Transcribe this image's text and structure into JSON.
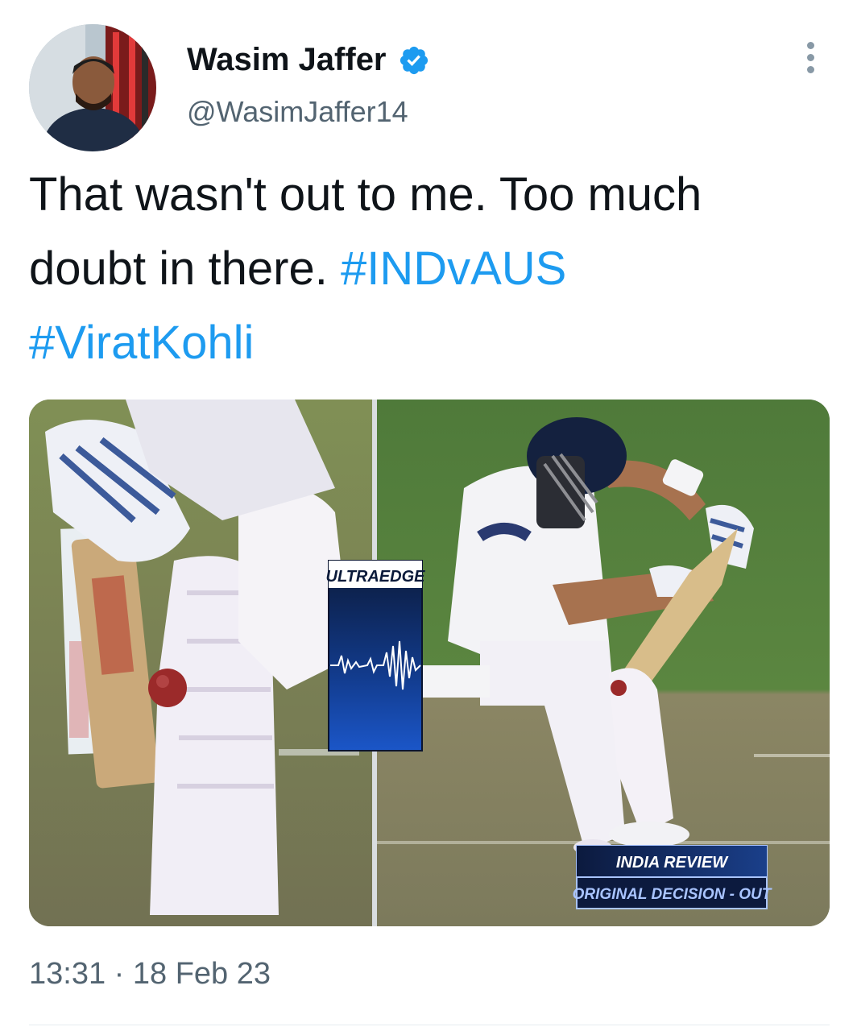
{
  "tweet": {
    "author_name": "Wasim Jaffer",
    "author_handle": "@WasimJaffer14",
    "text_plain": "That wasn't out to me. Too much doubt in there.",
    "hashtags": [
      "#INDvAUS",
      "#ViratKohli"
    ],
    "timestamp": "13:31 · 18 Feb 23",
    "verified": true
  },
  "media": {
    "ultraedge_label": "ULTRAEDGE",
    "review_title": "INDIA REVIEW",
    "review_decision": "ORIGINAL DECISION - OUT"
  },
  "colors": {
    "link": "#1d9bf0",
    "text": "#0f1419",
    "secondary": "#536471",
    "verified_badge": "#1d9bf0"
  },
  "icons": {
    "verified": "verified-badge-icon",
    "more": "more-options-icon"
  }
}
